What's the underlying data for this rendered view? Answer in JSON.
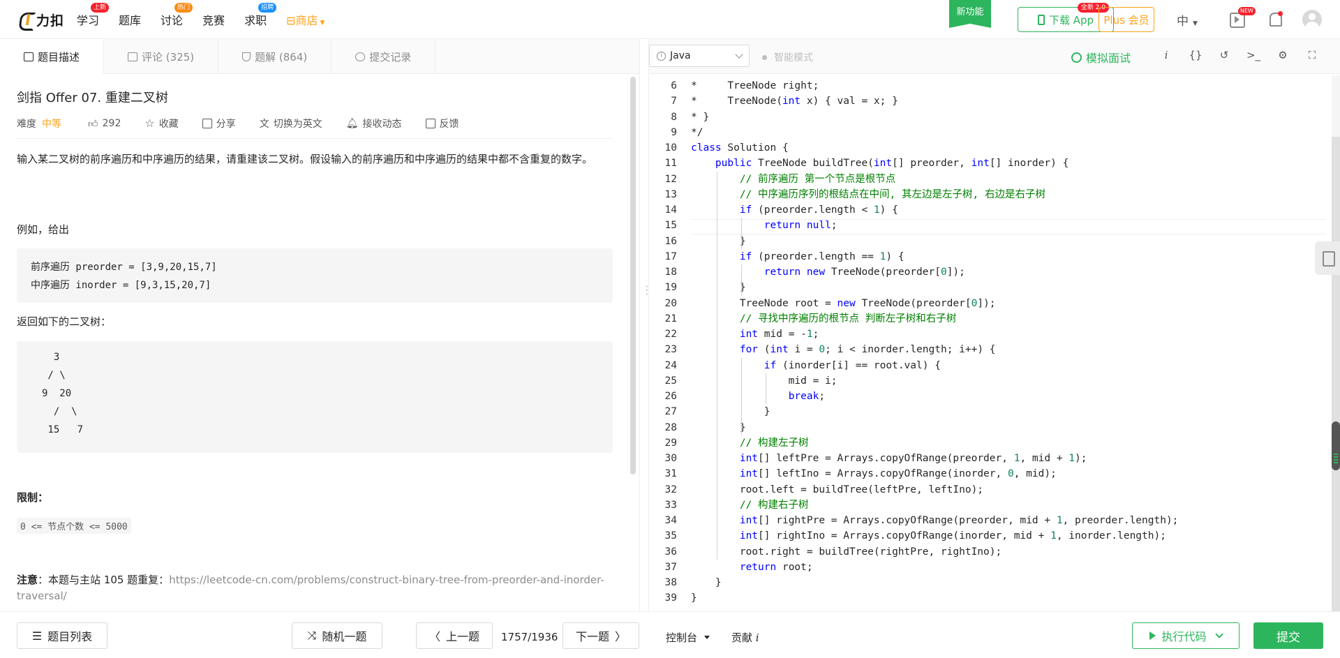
{
  "brand": {
    "name": "力扣"
  },
  "nav": {
    "items": [
      {
        "label": "学习",
        "badge": "上新",
        "badge_color": "red"
      },
      {
        "label": "题库",
        "badge": "",
        "badge_color": ""
      },
      {
        "label": "讨论",
        "badge": "热门",
        "badge_color": "orange"
      },
      {
        "label": "竞赛",
        "badge": "",
        "badge_color": ""
      },
      {
        "label": "求职",
        "badge": "招聘",
        "badge_color": "blue"
      },
      {
        "label": "商店",
        "badge": "",
        "badge_color": ""
      }
    ],
    "new_feature": "新功能",
    "download_app": "下载 App",
    "download_badge": "全新 2.0",
    "plus": "Plus 会员",
    "language": "中",
    "new_badge": "NEW"
  },
  "tabs": {
    "description": "题目描述",
    "comments": "评论 (325)",
    "solutions": "题解 (864)",
    "submissions": "提交记录"
  },
  "problem": {
    "title": "剑指 Offer 07. 重建二叉树",
    "difficulty_label": "难度",
    "difficulty": "中等",
    "likes": "292",
    "favorite": "收藏",
    "share": "分享",
    "switch_lang": "切换为英文",
    "notify": "接收动态",
    "feedback": "反馈",
    "description": "输入某二叉树的前序遍历和中序遍历的结果，请重建该二叉树。假设输入的前序遍历和中序遍历的结果中都不含重复的数字。",
    "example_intro": "例如，给出",
    "example_lines": [
      "前序遍历 preorder = [3,9,20,15,7]",
      "中序遍历 inorder = [9,3,15,20,7]"
    ],
    "returns_intro": "返回如下的二叉树：",
    "tree_lines": [
      "  3",
      " / \\",
      "9  20",
      "  /  \\",
      " 15   7"
    ],
    "limits_title": "限制：",
    "limits_code": "0 <= 节点个数 <= 5000",
    "note_label": "注意",
    "note_text": "：本题与主站 105 题重复：",
    "note_link": "https://leetcode-cn.com/problems/construct-binary-tree-from-preorder-and-inorder-traversal/"
  },
  "editor": {
    "language": "Java",
    "smart_mode": "智能模式",
    "mock_interview": "模拟面试",
    "toolbar_icons": [
      "info-icon",
      "braces-icon",
      "reset-icon",
      "terminal-icon",
      "settings-icon",
      "fullscreen-icon"
    ],
    "first_line": 6,
    "current_line": 15,
    "lines": [
      "*     TreeNode right;",
      "*     TreeNode(int x) { val = x; }",
      "* }",
      "*/",
      "class Solution {",
      "    public TreeNode buildTree(int[] preorder, int[] inorder) {",
      "        // 前序遍历 第一个节点是根节点",
      "        // 中序遍历序列的根结点在中间, 其左边是左子树, 右边是右子树",
      "        if (preorder.length < 1) {",
      "            return null;",
      "        }",
      "        if (preorder.length == 1) {",
      "            return new TreeNode(preorder[0]);",
      "        }",
      "        TreeNode root = new TreeNode(preorder[0]);",
      "        // 寻找中序遍历的根节点 判断左子树和右子树",
      "        int mid = -1;",
      "        for (int i = 0; i < inorder.length; i++) {",
      "            if (inorder[i] == root.val) {",
      "                mid = i;",
      "                break;",
      "            }",
      "        }",
      "        // 构建左子树",
      "        int[] leftPre = Arrays.copyOfRange(preorder, 1, mid + 1);",
      "        int[] leftIno = Arrays.copyOfRange(inorder, 0, mid);",
      "        root.left = buildTree(leftPre, leftIno);",
      "        // 构建右子树",
      "        int[] rightPre = Arrays.copyOfRange(preorder, mid + 1, preorder.length);",
      "        int[] rightIno = Arrays.copyOfRange(inorder, mid + 1, inorder.length);",
      "        root.right = buildTree(rightPre, rightIno);",
      "        return root;",
      "    }",
      "}"
    ]
  },
  "footer": {
    "problem_list": "题目列表",
    "random": "随机一题",
    "prev": "上一题",
    "page": "1757/1936",
    "next": "下一题",
    "console": "控制台",
    "contribute": "贡献",
    "run": "执行代码",
    "submit": "提交"
  },
  "colors": {
    "accent": "#2db55d",
    "medium": "#ffa116",
    "hot": "#f5222d"
  }
}
